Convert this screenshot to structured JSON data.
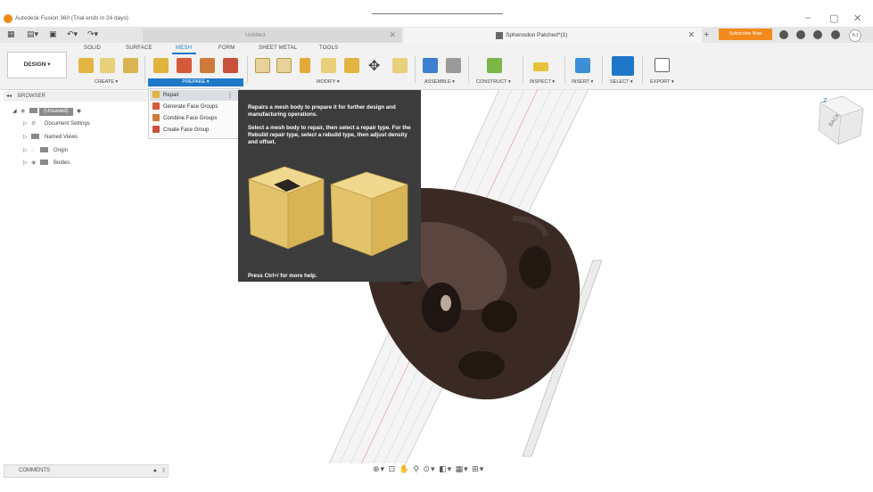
{
  "window": {
    "title": "Autodesk Fusion 360 (Trial ends in 24 days)",
    "controls": [
      "–",
      "▢",
      "✕"
    ]
  },
  "tabs": [
    {
      "label": "Untitled",
      "close": "✕"
    },
    {
      "label": "Sphenodon Patched*(1)",
      "close": "✕"
    }
  ],
  "tab_plus": "+",
  "subscribe_label": "Subscribe Now",
  "user_initials": "KJ",
  "ribbon": {
    "workspace": "DESIGN ▾",
    "tabs": [
      "SOLID",
      "SURFACE",
      "MESH",
      "FORM",
      "SHEET METAL",
      "TOOLS"
    ],
    "active_tab": "MESH",
    "groups": [
      "CREATE ▾",
      "PREPARE ▾",
      "MODIFY ▾",
      "ASSEMBLE ▾",
      "CONSTRUCT ▾",
      "INSPECT ▾",
      "INSERT ▾",
      "SELECT ▾",
      "EXPORT ▾"
    ]
  },
  "browser": {
    "header": "BROWSER",
    "root": "(Unsaved)",
    "items": [
      "Document Settings",
      "Named Views",
      "Origin",
      "Bodies"
    ]
  },
  "prepare_menu": {
    "items": [
      "Repair",
      "Generate Face Groups",
      "Combine Face Groups",
      "Create Face Group"
    ],
    "more": "⋮"
  },
  "tooltip": {
    "p1": "Repairs a mesh body to prepare it for further design and manufacturing operations.",
    "p2": "Select a mesh body to repair, then select a repair type. For the Rebuild repair type, select a rebuild type, then adjust density and offset.",
    "footer": "Press Ctrl+/ for more help."
  },
  "viewcube": {
    "face": "BACK",
    "axis": "Z"
  },
  "comments_label": "COMMENTS",
  "colors": {
    "accent": "#1e78c8",
    "subscribe": "#f28a1e",
    "tooltip_bg": "#3c3c3c",
    "mesh_body": "#3b2a24",
    "cube_face": "#e3c97a"
  }
}
